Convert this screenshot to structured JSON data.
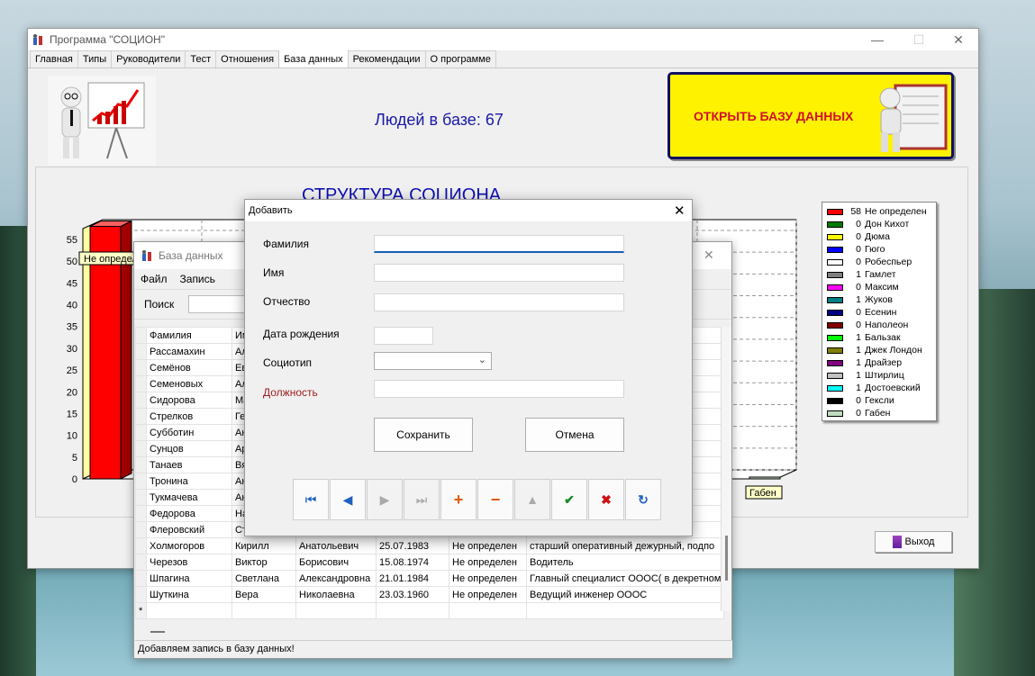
{
  "main_window": {
    "title": "Программа \"СОЦИОН\"",
    "tabs": [
      "Главная",
      "Типы",
      "Руководители",
      "Тест",
      "Отношения",
      "База данных",
      "Рекомендации",
      "О программе"
    ],
    "active_tab": "База данных",
    "people_count": "Людей в базе: 67",
    "open_db_label": "ОТКРЫТЬ БАЗУ ДАННЫХ",
    "chart_title": "СТРУКТУРА СОЦИОНА",
    "exit_label": "Выход"
  },
  "chart_data": {
    "type": "bar",
    "title": "СТРУКТУРА СОЦИОНА",
    "categories": [
      "Не определен",
      "Дон Кихот",
      "Дюма",
      "Гюго",
      "Робеспьер",
      "Гамлет",
      "Максим",
      "Жуков",
      "Есенин",
      "Наполеон",
      "Бальзак",
      "Джек Лондон",
      "Драйзер",
      "Штирлиц",
      "Достоевский",
      "Гексли",
      "Габен"
    ],
    "values": [
      58,
      0,
      0,
      0,
      0,
      1,
      0,
      1,
      0,
      0,
      1,
      1,
      1,
      1,
      1,
      0,
      0
    ],
    "colors": [
      "#ff0000",
      "#007a00",
      "#ffff00",
      "#0000ff",
      "#ffffff",
      "#808080",
      "#ff00ff",
      "#008080",
      "#000080",
      "#800000",
      "#00ff00",
      "#808000",
      "#800080",
      "#c0c0c0",
      "#00ffff",
      "#000000",
      "#c0dcc0"
    ],
    "ylim": [
      0,
      55
    ],
    "yticks": [
      0,
      5,
      10,
      15,
      20,
      25,
      30,
      35,
      40,
      45,
      50,
      55
    ],
    "x_tick_labels": [
      "Не определен",
      "Габен"
    ],
    "bar_labels": [
      "Не определен",
      "Габен"
    ],
    "grid": true,
    "legend": "right"
  },
  "db_window": {
    "title": "База данных",
    "menu": [
      "Файл",
      "Запись"
    ],
    "search_label": "Поиск",
    "columns": [
      "Фамилия",
      "Им"
    ],
    "rows": [
      [
        "Рассамахин",
        "Ал",
        "",
        "",
        "",
        ""
      ],
      [
        "Семёнов",
        "Ев",
        "",
        "",
        "",
        "начал"
      ],
      [
        "Семеновых",
        "Ал",
        "",
        "",
        "",
        ""
      ],
      [
        "Сидорова",
        "Ма",
        "",
        "",
        "",
        ""
      ],
      [
        "Стрелков",
        "Ге",
        "",
        "",
        "",
        "в Гу"
      ],
      [
        "Субботин",
        "Ан",
        "",
        "",
        "",
        ""
      ],
      [
        "Сунцов",
        "Ар",
        "",
        "",
        "",
        "н"
      ],
      [
        "Танаев",
        "Вя",
        "",
        "",
        "",
        "нени"
      ],
      [
        "Тронина",
        "Ан",
        "",
        "",
        "",
        ""
      ],
      [
        "Тукмачева",
        "Ан",
        "",
        "",
        "",
        ""
      ],
      [
        "Федорова",
        "На",
        "",
        "",
        "",
        ""
      ],
      [
        "Флеровский",
        "Ст",
        "",
        "",
        "",
        ""
      ],
      [
        "Холмогоров",
        "Кирилл",
        "Анатольевич",
        "25.07.1983",
        "Не определен",
        "старший оперативный дежурный, подпо"
      ],
      [
        "Черезов",
        "Виктор",
        "Борисович",
        "15.08.1974",
        "Не определен",
        "Водитель"
      ],
      [
        "Шпагина",
        "Светлана",
        "Александровна",
        "21.01.1984",
        "Не определен",
        "Главный специалист ОООС( в декретном"
      ],
      [
        "Шуткина",
        "Вера",
        "Николаевна",
        "23.03.1960",
        "Не определен",
        "Ведущий инженер ОООС"
      ]
    ],
    "new_row_marker": "*",
    "status": "Добавляем запись в базу данных!"
  },
  "add_dialog": {
    "title": "Добавить",
    "fields": [
      "Фамилия",
      "Имя",
      "Отчество",
      "Дата рождения",
      "Социотип",
      "Должность"
    ],
    "save_label": "Сохранить",
    "cancel_label": "Отмена"
  }
}
